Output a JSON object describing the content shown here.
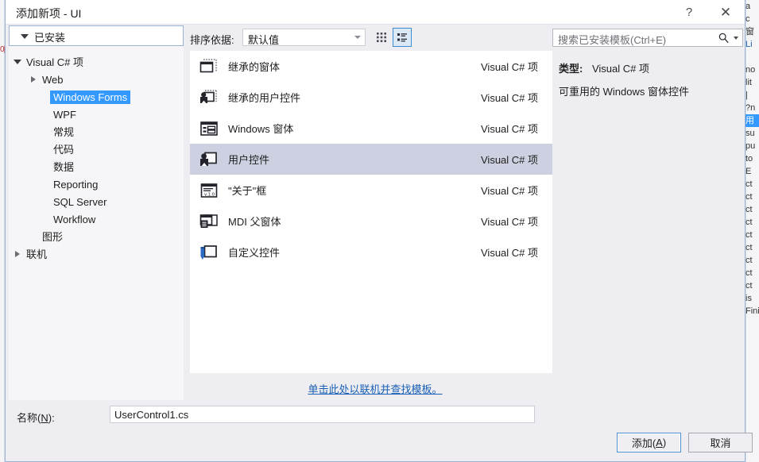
{
  "window": {
    "title": "添加新项 - UI",
    "help_button": "?",
    "close_button": "✕"
  },
  "toolbar": {
    "sort_label": "排序依据:",
    "sort_value": "默认值",
    "view_tiles_icon": "tiles-view-icon",
    "view_list_icon": "list-view-icon",
    "search_placeholder": "搜索已安装模板(Ctrl+E)",
    "search_icon": "search-icon"
  },
  "tree": {
    "header": "已安装",
    "nodes": [
      {
        "label": "Visual C# 项",
        "level": 0,
        "expander": "down",
        "selected": false
      },
      {
        "label": "Web",
        "level": 1,
        "expander": "right",
        "selected": false
      },
      {
        "label": "Windows Forms",
        "level": 2,
        "expander": "none",
        "selected": true
      },
      {
        "label": "WPF",
        "level": 2,
        "expander": "none",
        "selected": false
      },
      {
        "label": "常规",
        "level": 2,
        "expander": "none",
        "selected": false
      },
      {
        "label": "代码",
        "level": 2,
        "expander": "none",
        "selected": false
      },
      {
        "label": "数据",
        "level": 2,
        "expander": "none",
        "selected": false
      },
      {
        "label": "Reporting",
        "level": 2,
        "expander": "none",
        "selected": false
      },
      {
        "label": "SQL Server",
        "level": 2,
        "expander": "none",
        "selected": false
      },
      {
        "label": "Workflow",
        "level": 2,
        "expander": "none",
        "selected": false
      },
      {
        "label": "图形",
        "level": 1,
        "expander": "none",
        "selected": false
      },
      {
        "label": "联机",
        "level": 0,
        "expander": "right",
        "selected": false
      }
    ]
  },
  "templates": {
    "items": [
      {
        "name": "继承的窗体",
        "category": "Visual C# 项",
        "icon": "inherited-form-icon",
        "selected": false
      },
      {
        "name": "继承的用户控件",
        "category": "Visual C# 项",
        "icon": "inherited-user-control-icon",
        "selected": false
      },
      {
        "name": "Windows 窗体",
        "category": "Visual C# 项",
        "icon": "windows-form-icon",
        "selected": false
      },
      {
        "name": "用户控件",
        "category": "Visual C# 项",
        "icon": "user-control-icon",
        "selected": true
      },
      {
        "name": "\"关于\"框",
        "category": "Visual C# 项",
        "icon": "about-box-icon",
        "selected": false
      },
      {
        "name": "MDI 父窗体",
        "category": "Visual C# 项",
        "icon": "mdi-parent-form-icon",
        "selected": false
      },
      {
        "name": "自定义控件",
        "category": "Visual C# 项",
        "icon": "custom-control-icon",
        "selected": false
      }
    ],
    "online_link": "单击此处以联机并查找模板。"
  },
  "info": {
    "type_label": "类型:",
    "type_value": "Visual C# 项",
    "description": "可重用的 Windows 窗体控件"
  },
  "name_field": {
    "label_prefix": "名称(",
    "label_accel": "N",
    "label_suffix": "):",
    "value": "UserControl1.cs"
  },
  "footer": {
    "add_prefix": "添加(",
    "add_accel": "A",
    "add_suffix": ")",
    "cancel": "取消"
  },
  "colors": {
    "selection_blue": "#3399ff",
    "row_selected": "#cdd0e0",
    "dialog_bg": "#eeeef2",
    "link": "#1a5fb4",
    "border_accent": "#9ab4d6"
  },
  "background": {
    "solution_explorer_lines": [
      "a",
      "c",
      "窗",
      "Li",
      "",
      "no",
      "lit",
      "|",
      "?n",
      "用",
      "su",
      "pu",
      "to",
      "E",
      "ct",
      "ct",
      "ct",
      "ct",
      "ct",
      "ct",
      "ct",
      "ct",
      "ct",
      "is",
      "Finis"
    ]
  }
}
